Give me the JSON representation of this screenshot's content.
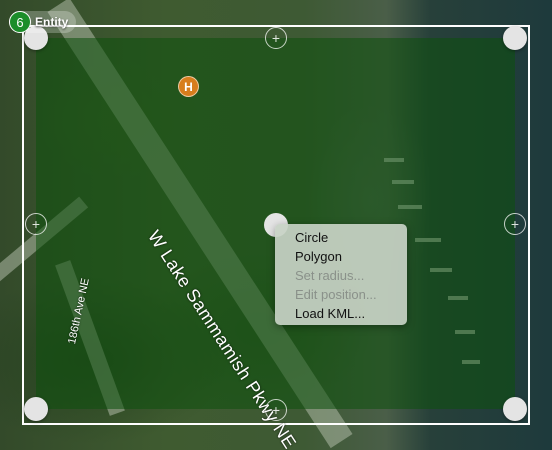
{
  "entity_badge": {
    "count": "6",
    "label": "Entity"
  },
  "poi_marker": {
    "label": "H",
    "color": "#d77d1d"
  },
  "streets": {
    "main": "W Lake Sammamish Pkwy NE",
    "side": "186th Ave NE"
  },
  "region": {
    "fill_color": "#0c500c",
    "frame_color": "#ffffff"
  },
  "icons": {
    "mid_handle": "plus-icon"
  },
  "context_menu": {
    "items": [
      {
        "label": "Circle",
        "enabled": true
      },
      {
        "label": "Polygon",
        "enabled": true
      },
      {
        "label": "Set radius...",
        "enabled": false
      },
      {
        "label": "Edit position...",
        "enabled": false
      },
      {
        "label": "Load KML...",
        "enabled": true
      }
    ]
  }
}
